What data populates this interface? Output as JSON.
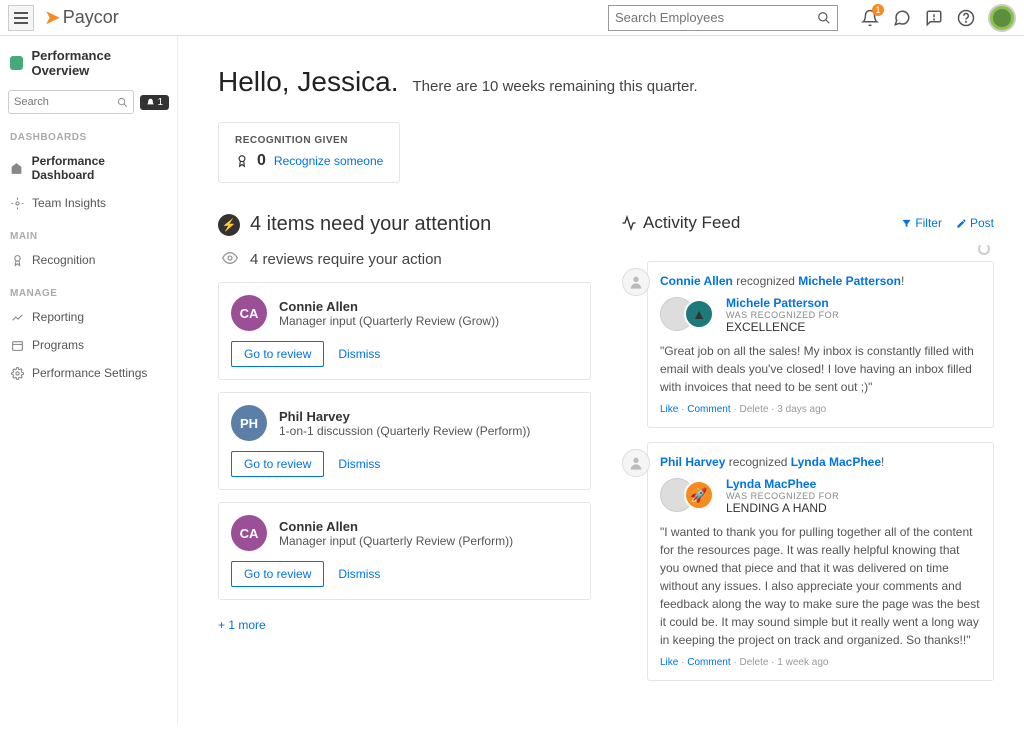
{
  "header": {
    "logo_text": "Paycor",
    "search_placeholder": "Search Employees",
    "notif_count": "1"
  },
  "sidebar": {
    "title": "Performance Overview",
    "search_placeholder": "Search",
    "bell_count": "1",
    "sections": {
      "dashboards": "DASHBOARDS",
      "main": "MAIN",
      "manage": "MANAGE"
    },
    "items": {
      "perf_dash": "Performance Dashboard",
      "team_insights": "Team Insights",
      "recognition": "Recognition",
      "reporting": "Reporting",
      "programs": "Programs",
      "perf_settings": "Performance Settings"
    }
  },
  "greeting": {
    "hello": "Hello, Jessica.",
    "sub": "There are 10 weeks remaining this quarter."
  },
  "recognition_card": {
    "label": "RECOGNITION GIVEN",
    "count": "0",
    "link": "Recognize someone"
  },
  "attention": {
    "heading": "4 items need your attention",
    "sub": "4 reviews require your action",
    "reviews": [
      {
        "initials": "CA",
        "avatar_class": "av-purple",
        "name": "Connie Allen",
        "desc": "Manager input (Quarterly Review (Grow))"
      },
      {
        "initials": "PH",
        "avatar_class": "av-blue",
        "name": "Phil Harvey",
        "desc": "1-on-1 discussion (Quarterly Review (Perform))"
      },
      {
        "initials": "CA",
        "avatar_class": "av-purple",
        "name": "Connie Allen",
        "desc": "Manager input (Quarterly Review (Perform))"
      }
    ],
    "go_to_review": "Go to review",
    "dismiss": "Dismiss",
    "more": "+ 1 more"
  },
  "feed": {
    "title": "Activity Feed",
    "filter": "Filter",
    "post": "Post",
    "items": [
      {
        "actor": "Connie Allen",
        "verb": "recognized",
        "target": "Michele Patterson",
        "rec_name": "Michele Patterson",
        "rec_label": "WAS RECOGNIZED FOR",
        "rec_value": "EXCELLENCE",
        "av2_class": "teal",
        "body": "\"Great job on all the sales! My inbox is constantly filled with email with deals you've closed! I love having an inbox filled with invoices that need to be sent out ;)\"",
        "time": "3 days ago"
      },
      {
        "actor": "Phil Harvey",
        "verb": "recognized",
        "target": "Lynda MacPhee",
        "rec_name": "Lynda MacPhee",
        "rec_label": "WAS RECOGNIZED FOR",
        "rec_value": "LENDING A HAND",
        "av2_class": "orange",
        "body": "\"I wanted to thank you for pulling together all of the content for the resources page. It was really helpful knowing that you owned that piece and that it was delivered on time without any issues. I also appreciate your comments and feedback along the way to make sure the page was the best it could be. It may sound simple but it really went a long way in keeping the project on track and organized. So thanks!!\"",
        "time": "1 week ago"
      }
    ],
    "like": "Like",
    "comment": "Comment",
    "delete": "Delete"
  }
}
